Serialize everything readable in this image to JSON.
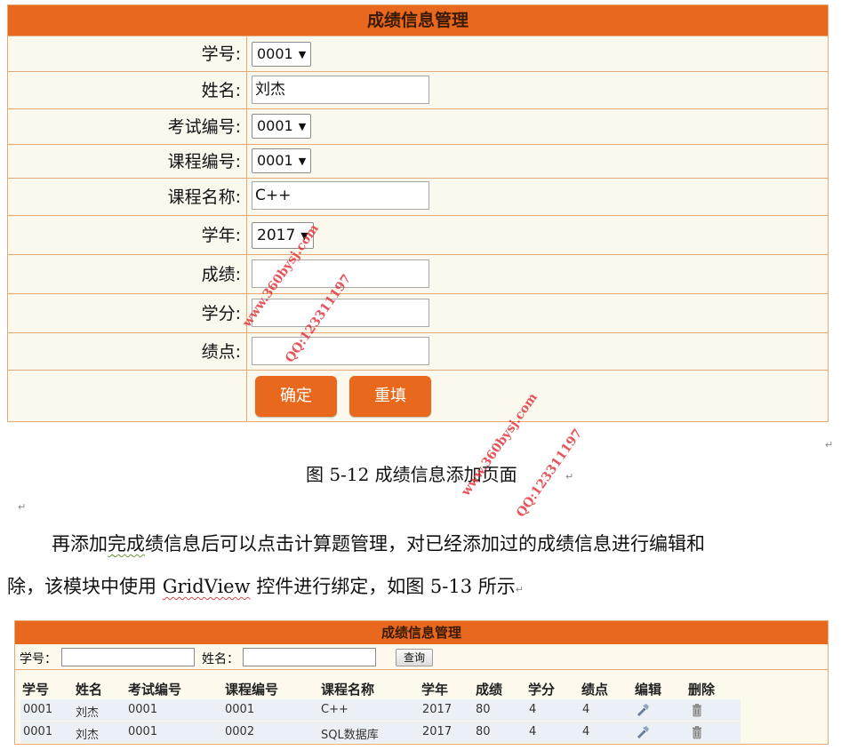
{
  "form": {
    "title": "成绩信息管理",
    "fields": [
      {
        "label": "学号:",
        "type": "select",
        "value": "0001"
      },
      {
        "label": "姓名:",
        "type": "text",
        "value": "刘杰"
      },
      {
        "label": "考试编号:",
        "type": "select",
        "value": "0001"
      },
      {
        "label": "课程编号:",
        "type": "select",
        "value": "0001"
      },
      {
        "label": "课程名称:",
        "type": "text",
        "value": "C++"
      },
      {
        "label": "学年:",
        "type": "select",
        "value": "2017"
      },
      {
        "label": "成绩:",
        "type": "text",
        "value": ""
      },
      {
        "label": "学分:",
        "type": "text",
        "value": ""
      },
      {
        "label": "绩点:",
        "type": "text",
        "value": ""
      }
    ],
    "confirm_label": "确定",
    "reset_label": "重填"
  },
  "doc": {
    "caption": "图 5-12 成绩信息添加页面",
    "para1_a": "再添加",
    "para1_b": "完成",
    "para1_c": "绩信息后可以点击计算题管理，对已经添加过的成绩信息进行编辑和",
    "para2_a": "除，该模块中使用 ",
    "para2_b": "GridView",
    "para2_c": " 控件进行绑定，如图 5-13 所示",
    "return_mark": "↵"
  },
  "watermarks": {
    "site": "www.360bysj.com",
    "qq": "QQ:123311197"
  },
  "grid": {
    "title": "成绩信息管理",
    "search_id_label": "学号：",
    "search_name_label": "姓名：",
    "query_label": "查询",
    "headers": [
      "学号",
      "姓名",
      "考试编号",
      "课程编号",
      "课程名称",
      "学年",
      "成绩",
      "学分",
      "绩点",
      "编辑",
      "删除"
    ],
    "rows": [
      [
        "0001",
        "刘杰",
        "0001",
        "0001",
        "C++",
        "2017",
        "80",
        "4",
        "4"
      ],
      [
        "0001",
        "刘杰",
        "0001",
        "0002",
        "SQL数据库",
        "2017",
        "80",
        "4",
        "4"
      ]
    ],
    "edit_icon": "edit-icon",
    "delete_icon": "trash-icon"
  }
}
